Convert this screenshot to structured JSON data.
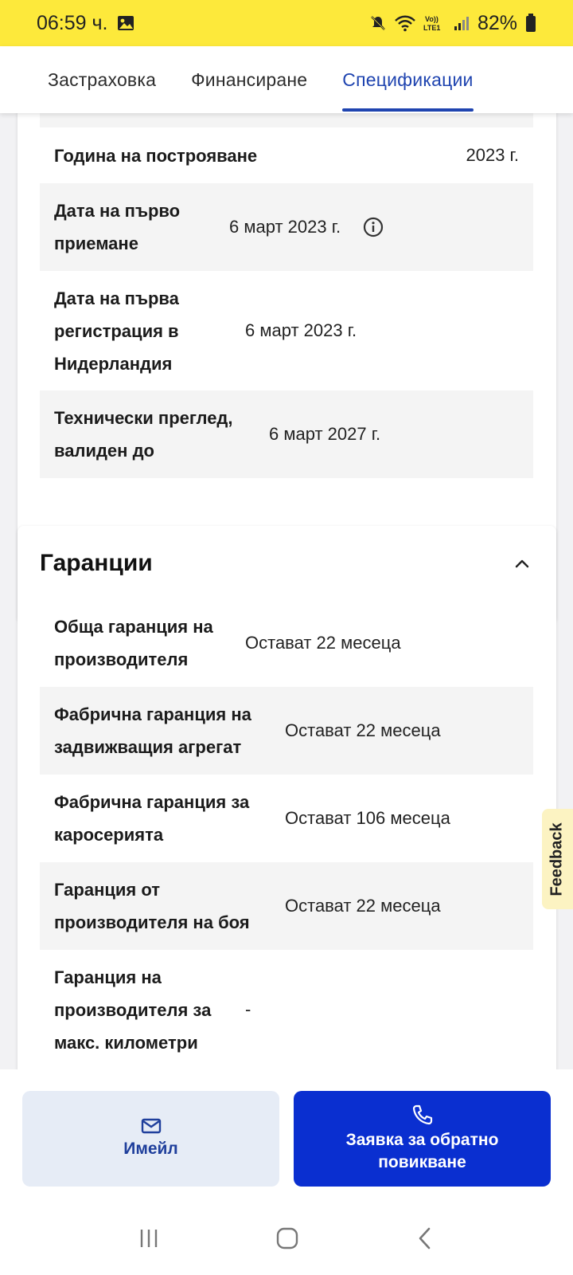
{
  "status_bar": {
    "time": "06:59 ч.",
    "battery": "82%",
    "network": "VoLTE1"
  },
  "tabs": [
    {
      "label": "Застраховка",
      "active": false
    },
    {
      "label": "Финансиране",
      "active": false
    },
    {
      "label": "Спецификации",
      "active": true
    }
  ],
  "specs": {
    "rows": [
      {
        "label": "Година на построяване",
        "value": "2023 г."
      },
      {
        "label": "Дата на първо приемане",
        "value": "6 март 2023 г."
      },
      {
        "label": "Дата на първа регистрация в Нидерландия",
        "value": "6 март 2023 г."
      },
      {
        "label": "Технически преглед, валиден до",
        "value": "6 март 2027 г."
      }
    ]
  },
  "warranties": {
    "title": "Гаранции",
    "rows": [
      {
        "label": "Обща гаранция на производителя",
        "value": "Остават 22 месеца"
      },
      {
        "label": "Фабрична гаранция на задвижващия агрегат",
        "value": "Остават 22 месеца"
      },
      {
        "label": "Фабрична гаранция за каросерията",
        "value": "Остават 106 месеца"
      },
      {
        "label": "Гаранция от производителя на боя",
        "value": "Остават 22 месеца"
      },
      {
        "label": "Гаранция на производителя за макс. километри",
        "value": "-"
      }
    ]
  },
  "feedback": {
    "label": "Feedback"
  },
  "actions": {
    "email_label": "Имейл",
    "callback_label": "Заявка за обратно повикване"
  },
  "colors": {
    "status_bar_bg": "#fde93b",
    "accent": "#1f44b0",
    "primary_button": "#0a2fd0",
    "secondary_button": "#e6ecf6"
  }
}
